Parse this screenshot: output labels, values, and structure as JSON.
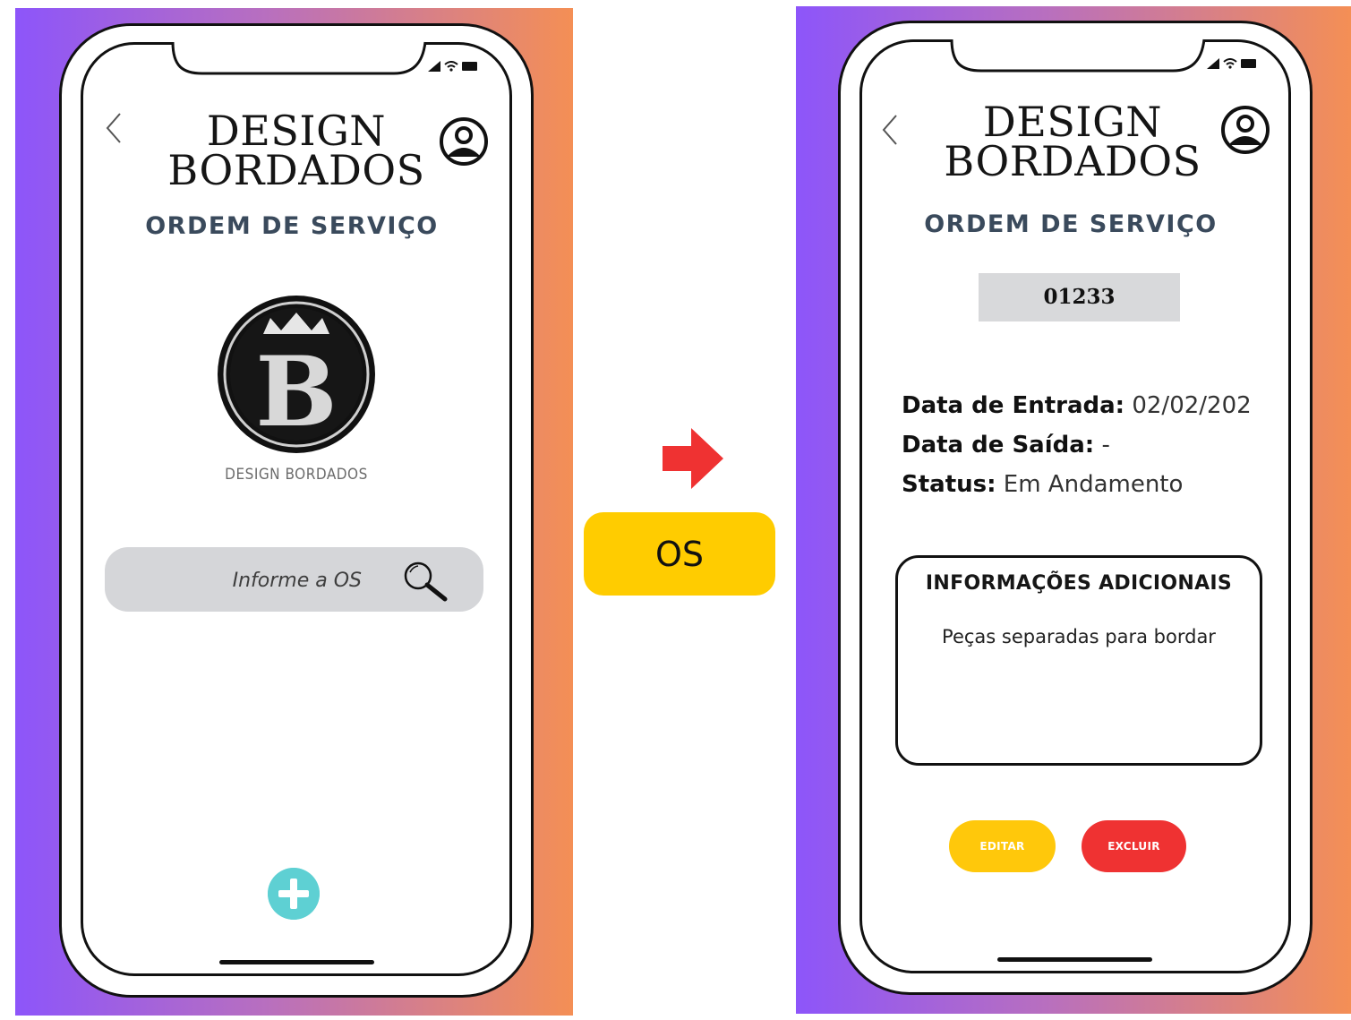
{
  "colors": {
    "gradient_start": "#8d55fa",
    "gradient_end": "#f48f55",
    "os_chip": "#ffcc00",
    "edit_button": "#ffc80b",
    "delete_button": "#ef3232",
    "fab": "#5ed0d3",
    "arrow": "#ef3232",
    "title_text": "#3a4a5c"
  },
  "left_screen": {
    "brand_line1": "DESIGN",
    "brand_line2": "BORDADOS",
    "title": "ORDEM DE SERVIÇO",
    "logo_letter": "B",
    "logo_caption": "DESIGN BORDADOS",
    "search_placeholder": "Informe a OS",
    "icons": [
      "back-chevron-icon",
      "profile-icon",
      "search-icon",
      "plus-icon",
      "signal-icon",
      "wifi-icon",
      "battery-icon"
    ]
  },
  "transition": {
    "label": "OS",
    "arrow_icon": "arrow-right-icon"
  },
  "right_screen": {
    "brand_line1": "DESIGN",
    "brand_line2": "BORDADOS",
    "title": "ORDEM DE SERVIÇO",
    "os_number": "01233",
    "fields": [
      {
        "label": "Data de Entrada:",
        "value": "02/02/202"
      },
      {
        "label": "Data de Saída:",
        "value": "-"
      },
      {
        "label": "Status:",
        "value": "Em Andamento"
      }
    ],
    "additional": {
      "title": "INFORMAÇÕES ADICIONAIS",
      "text": "Peças separadas para bordar"
    },
    "buttons": {
      "edit": "EDITAR",
      "delete": "EXCLUIR"
    }
  }
}
